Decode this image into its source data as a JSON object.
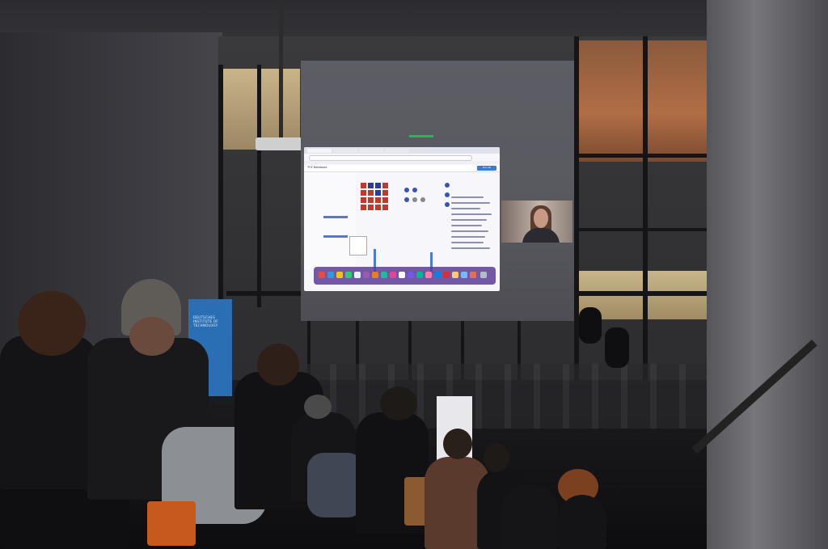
{
  "scene": {
    "description_tag": "",
    "colors": {
      "screen": "#5d5d65",
      "banner": "#2a6fb3",
      "dock": "#5a3c96",
      "accent_blue": "#4a7bd8"
    }
  },
  "banner": {
    "lines": [
      "DEUTSCHES",
      "INSTITUTE OF",
      "TECHNOLOGY"
    ]
  },
  "projection": {
    "app_title": "TFX Notebook",
    "action_button": "Run all",
    "webcam_label": ""
  },
  "icons": {
    "projector": "projector-icon",
    "webcam": "webcam-icon"
  }
}
